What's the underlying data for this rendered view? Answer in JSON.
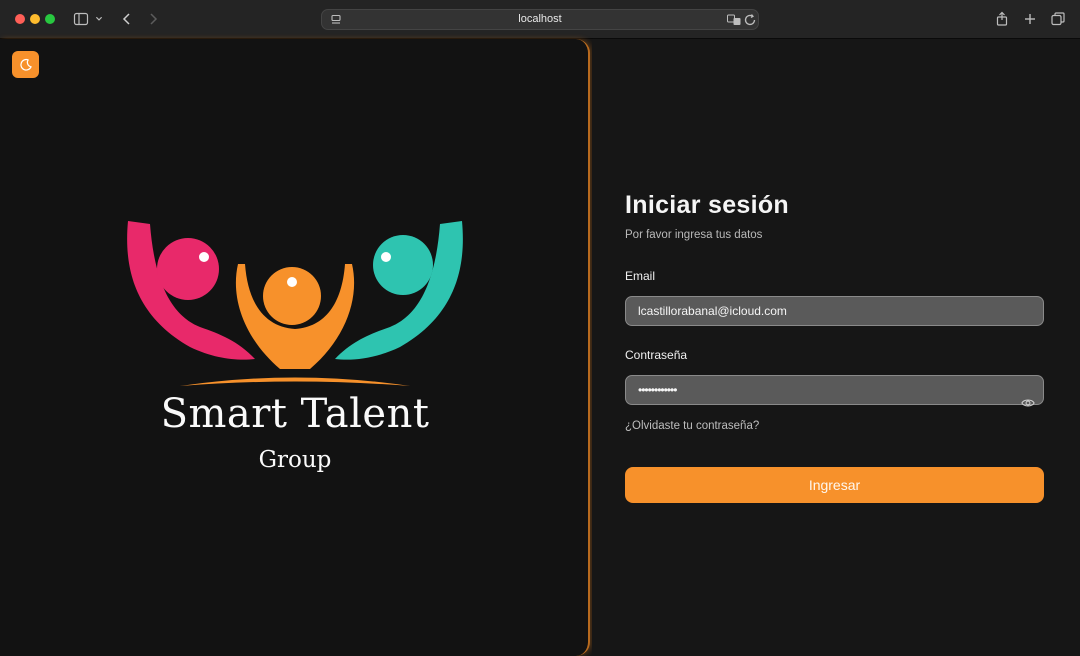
{
  "browser": {
    "url": "localhost"
  },
  "brand": {
    "name": "Smart Talent",
    "sub": "Group"
  },
  "login": {
    "title": "Iniciar sesión",
    "subtitle": "Por favor ingresa tus datos",
    "email_label": "Email",
    "email_value": "lcastillorabanal@icloud.com",
    "password_label": "Contraseña",
    "password_value": "••••••••••••",
    "forgot_link": "¿Olvidaste tu contraseña?",
    "submit_label": "Ingresar"
  },
  "icons": {
    "theme_toggle": "moon-icon",
    "password_visibility": "eye-icon"
  },
  "colors": {
    "accent": "#f7912b",
    "pink": "#e8296a",
    "teal": "#2ec4b0",
    "orange": "#f7912b"
  }
}
